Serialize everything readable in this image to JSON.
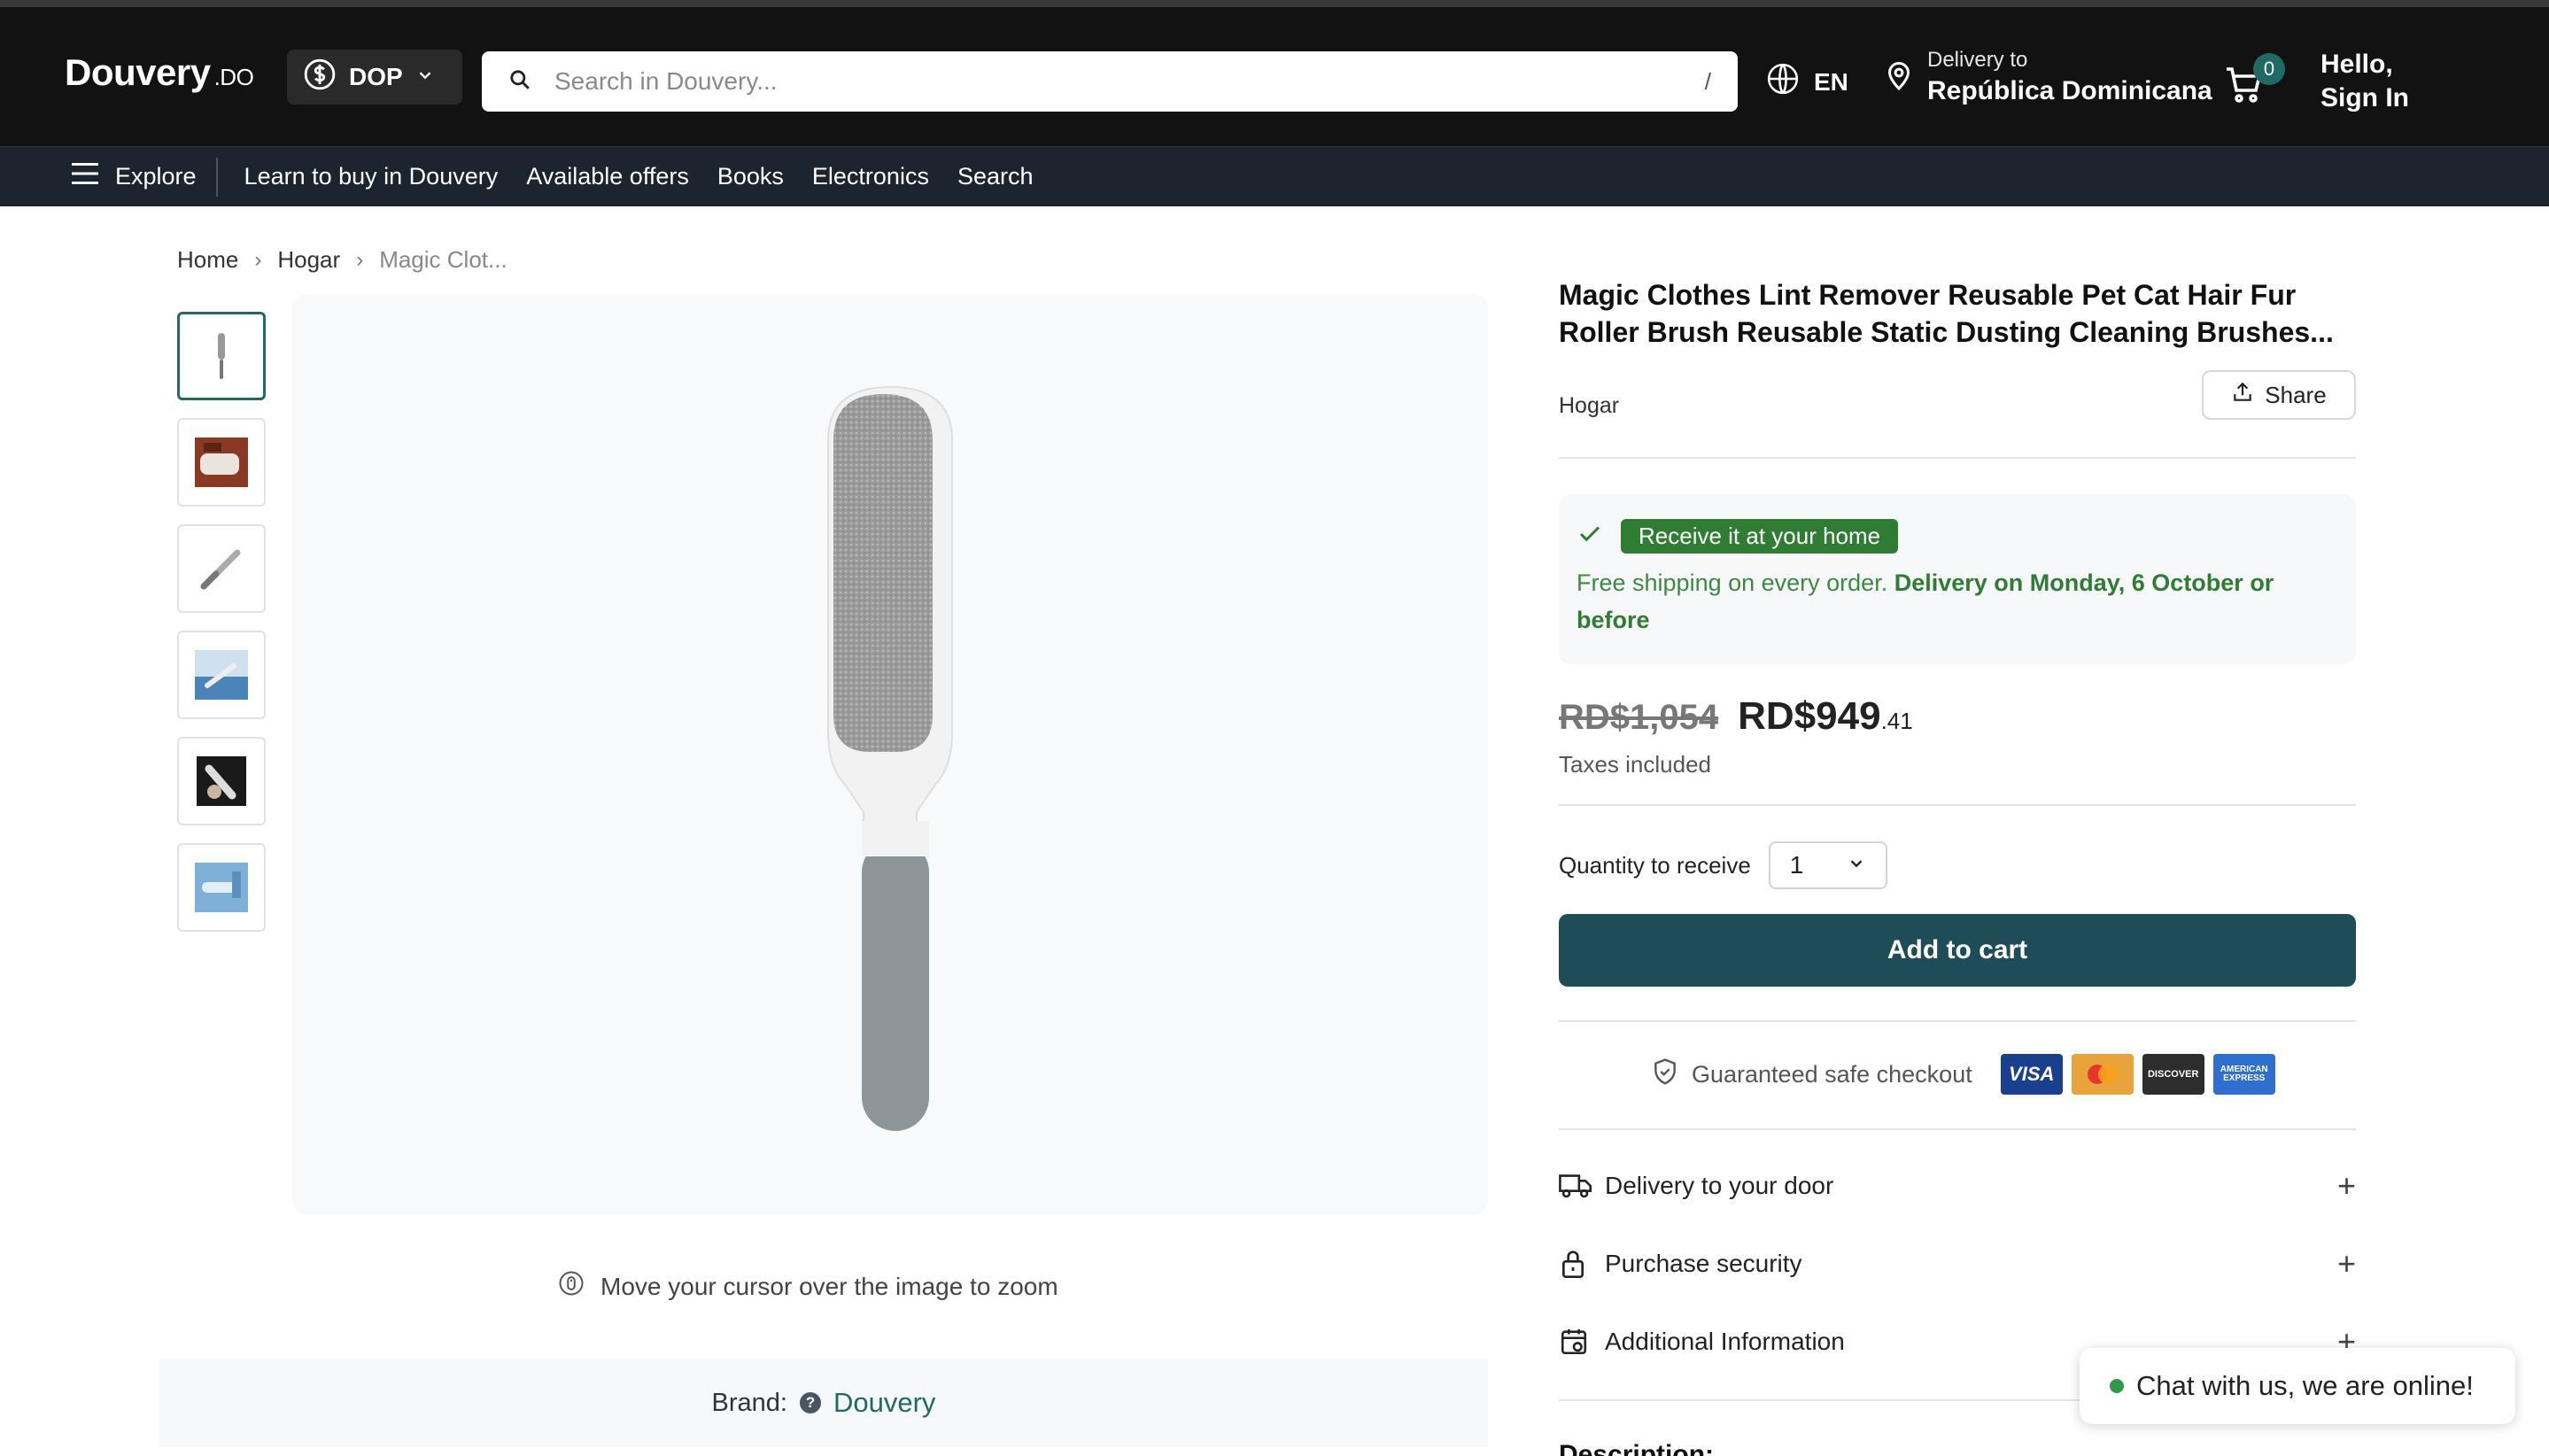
{
  "header": {
    "logo_text": "Douvery",
    "logo_tld": ".DO",
    "currency": "DOP",
    "search_placeholder": "Search in Douvery...",
    "search_shortcut": "/",
    "language": "EN",
    "delivery_label": "Delivery to",
    "delivery_country": "República Dominicana",
    "cart_count": "0",
    "greeting": "Hello,",
    "sign_in": "Sign In"
  },
  "nav": {
    "explore": "Explore",
    "items": [
      "Learn to buy in Douvery",
      "Available offers",
      "Books",
      "Electronics",
      "Search"
    ]
  },
  "breadcrumb": {
    "home": "Home",
    "category": "Hogar",
    "current": "Magic Clot..."
  },
  "gallery": {
    "thumbnail_count": 6,
    "zoom_hint": "Move your cursor over the image to zoom"
  },
  "brand": {
    "label": "Brand:",
    "name": "Douvery"
  },
  "product": {
    "title": "Magic Clothes Lint Remover Reusable Pet Cat Hair Fur Roller Brush Reusable Static Dusting Cleaning Brushes...",
    "category": "Hogar",
    "share_label": "Share",
    "shipping_badge": "Receive it at your home",
    "shipping_text": "Free shipping on every order.",
    "shipping_date": "Delivery on Monday, 6 October or before",
    "old_price": "RD$1,054",
    "price": "RD$949",
    "price_cents": ".41",
    "taxes": "Taxes included",
    "quantity_label": "Quantity to receive",
    "quantity_value": "1",
    "add_to_cart": "Add to cart",
    "safe_checkout": "Guaranteed safe checkout",
    "cards": {
      "visa": "VISA",
      "discover": "DISCOVER",
      "amex": "AMERICAN EXPRESS"
    }
  },
  "accordion": [
    {
      "label": "Delivery to your door",
      "icon": "truck-icon"
    },
    {
      "label": "Purchase security",
      "icon": "lock-icon"
    },
    {
      "label": "Additional Information",
      "icon": "calendar-info-icon"
    }
  ],
  "description_heading": "Description:",
  "chat": {
    "text": "Chat with us, we are online!"
  },
  "colors": {
    "accent": "#1d6b63",
    "button": "#1e4d57",
    "header_bg": "#121212",
    "nav_bg": "#1c2430",
    "success": "#2f7d32"
  }
}
